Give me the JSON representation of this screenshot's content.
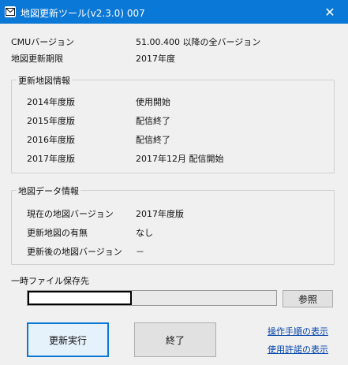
{
  "window": {
    "title": "地図更新ツール(v2.3.0) 007",
    "close_glyph": "✕"
  },
  "info": {
    "cmu_label": "CMUバージョン",
    "cmu_value": "51.00.400 以降の全バージョン",
    "deadline_label": "地図更新期限",
    "deadline_value": "2017年度"
  },
  "update_map_info": {
    "title": "更新地図情報",
    "rows": [
      {
        "label": "2014年度版",
        "value": "使用開始"
      },
      {
        "label": "2015年度版",
        "value": "配信終了"
      },
      {
        "label": "2016年度版",
        "value": "配信終了"
      },
      {
        "label": "2017年度版",
        "value": "2017年12月 配信開始"
      }
    ]
  },
  "map_data_info": {
    "title": "地図データ情報",
    "rows": [
      {
        "label": "現在の地図バージョン",
        "value": "2017年度版"
      },
      {
        "label": "更新地図の有無",
        "value": "なし"
      },
      {
        "label": "更新後の地図バージョン",
        "value": "－"
      }
    ]
  },
  "temp": {
    "label": "一時ファイル保存先",
    "browse_label": "参照"
  },
  "actions": {
    "run_label": "更新実行",
    "exit_label": "終了",
    "show_steps_link": "操作手順の表示",
    "show_license_link": "使用許諾の表示"
  },
  "icons": {
    "app": "mail-envelope-icon",
    "close": "close-icon"
  },
  "colors": {
    "titlebar": "#0a78d6",
    "link": "#0645ad",
    "primary_border": "#0a78d6"
  }
}
